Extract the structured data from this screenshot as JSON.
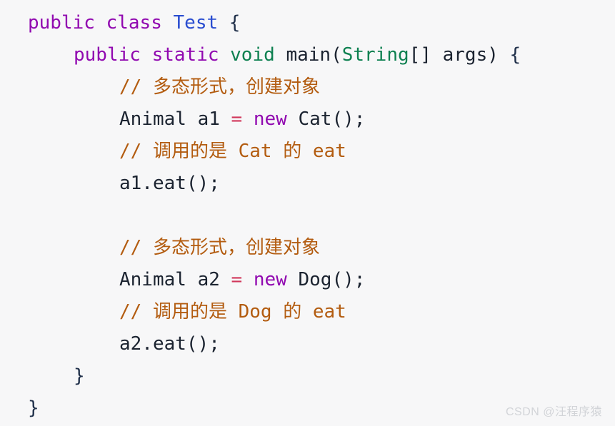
{
  "editor": {
    "language": "java",
    "background_color": "#f7f7f8",
    "font_size_px": 26,
    "line_height_px": 45,
    "colors": {
      "keyword": "#9109b0",
      "class_name": "#2a4dd0",
      "type": "#0d8050",
      "plain": "#1b2330",
      "operator": "#d1365a",
      "comment": "#b35c10",
      "brace": "#20304a",
      "watermark": "#d2d4d8"
    }
  },
  "code": {
    "line1": {
      "kw_public": "public",
      "sp1": " ",
      "kw_class": "class",
      "sp2": " ",
      "name_test": "Test",
      "sp3": " ",
      "brace_open": "{"
    },
    "line2": {
      "kw_public": "public",
      "sp1": " ",
      "kw_static": "static",
      "sp2": " ",
      "type_void": "void",
      "sp3": " ",
      "name_main": "main",
      "paren_open": "(",
      "type_string": "String",
      "brackets": "[]",
      "sp4": " ",
      "name_args": "args",
      "paren_close": ")",
      "sp5": " ",
      "brace_open": "{"
    },
    "line3_comment": "// 多态形式，创建对象",
    "line4": {
      "type_animal": "Animal",
      "sp1": " ",
      "var_a1": "a1",
      "sp2": " ",
      "op_assign": "=",
      "sp3": " ",
      "kw_new": "new",
      "sp4": " ",
      "type_cat": "Cat",
      "call": "();"
    },
    "line5_comment": "// 调用的是 Cat 的 eat",
    "line6": "a1.eat();",
    "line7_blank": "",
    "line8_comment": "// 多态形式，创建对象",
    "line9": {
      "type_animal": "Animal",
      "sp1": " ",
      "var_a2": "a2",
      "sp2": " ",
      "op_assign": "=",
      "sp3": " ",
      "kw_new": "new",
      "sp4": " ",
      "type_dog": "Dog",
      "call": "();"
    },
    "line10_comment": "// 调用的是 Dog 的 eat",
    "line11": "a2.eat();",
    "line12_brace": "}",
    "line13_brace": "}"
  },
  "watermark": {
    "text": "CSDN @汪程序猿"
  }
}
